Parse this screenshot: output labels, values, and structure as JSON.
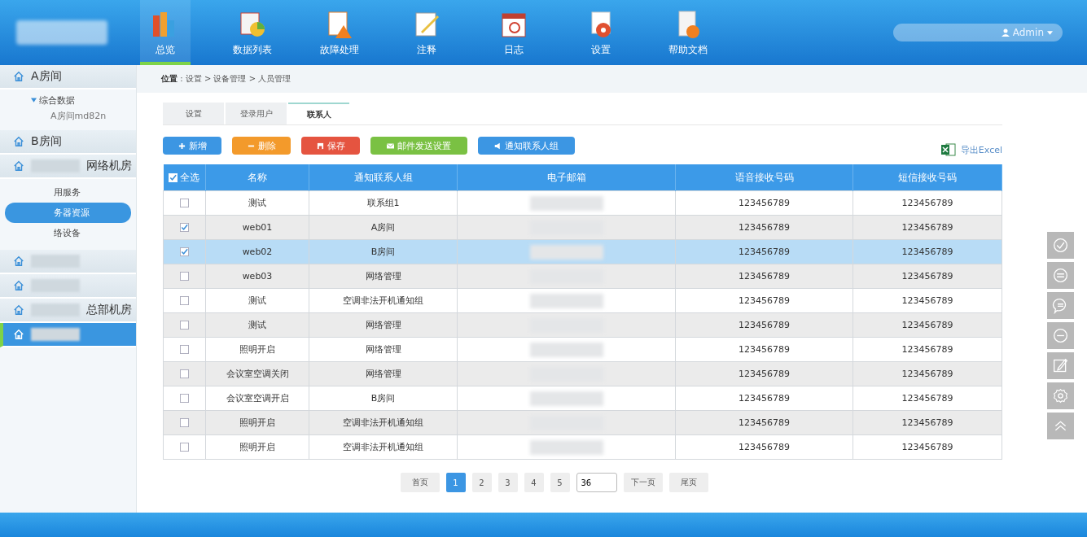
{
  "header": {
    "nav": [
      {
        "label": "总览",
        "selected": true
      },
      {
        "label": "数据列表",
        "selected": false
      },
      {
        "label": "故障处理",
        "selected": false
      },
      {
        "label": "注释",
        "selected": false
      },
      {
        "label": "日志",
        "selected": false
      },
      {
        "label": "设置",
        "selected": false
      },
      {
        "label": "帮助文档",
        "selected": false
      }
    ],
    "user": "Admin"
  },
  "sidebar": {
    "items": [
      {
        "label": "A房间",
        "selected": false,
        "children": [
          {
            "label": "综合数据",
            "kind": "folder",
            "children": [
              {
                "label": "A房间md82n",
                "kind": "leaf",
                "selected": false
              }
            ]
          }
        ]
      },
      {
        "label": "B房间",
        "selected": false
      },
      {
        "label": "网络机房",
        "selected": false,
        "children": [
          {
            "label": "用服务",
            "kind": "leaf",
            "selected": false
          },
          {
            "label": "务器资源",
            "kind": "leaf",
            "selected": true
          },
          {
            "label": "络设备",
            "kind": "leaf",
            "selected": false
          }
        ]
      },
      {
        "selected": false
      },
      {
        "selected": false
      },
      {
        "label": "总部机房",
        "selected": false
      },
      {
        "selected": true
      }
    ]
  },
  "breadcrumb": "**位置** : 设置 > 设备管理 > 人员管理",
  "tabs": [
    {
      "label": "设置",
      "selected": false
    },
    {
      "label": "登录用户",
      "selected": false
    },
    {
      "label": "联系人",
      "selected": true
    }
  ],
  "toolbar": [
    {
      "label": "新增",
      "kind": "add"
    },
    {
      "label": "删除",
      "kind": "delete"
    },
    {
      "label": "保存",
      "kind": "save"
    },
    {
      "label": "邮件发送设置",
      "kind": "mail"
    },
    {
      "label": "通知联系人组",
      "kind": "notify"
    }
  ],
  "export": "导出Excel",
  "table": {
    "select_all_checked": true,
    "columns": [
      "全选",
      "名称",
      "通知联系人组",
      "电子邮箱",
      "语音接收号码",
      "短信接收号码"
    ],
    "rows": [
      {
        "checked": false,
        "selected": false,
        "name": "测试",
        "group": "联系组1",
        "voice": "123456789",
        "sms": "123456789"
      },
      {
        "checked": true,
        "selected": false,
        "name": "web01",
        "group": "A房间",
        "voice": "123456789",
        "sms": "123456789"
      },
      {
        "checked": true,
        "selected": true,
        "name": "web02",
        "group": "B房间",
        "voice": "123456789",
        "sms": "123456789"
      },
      {
        "checked": false,
        "selected": false,
        "name": "web03",
        "group": "网络管理",
        "voice": "123456789",
        "sms": "123456789"
      },
      {
        "checked": false,
        "selected": false,
        "name": "测试",
        "group": "空调非法开机通知组",
        "voice": "123456789",
        "sms": "123456789"
      },
      {
        "checked": false,
        "selected": false,
        "name": "测试",
        "group": "网络管理",
        "voice": "123456789",
        "sms": "123456789"
      },
      {
        "checked": false,
        "selected": false,
        "name": "照明开启",
        "group": "网络管理",
        "voice": "123456789",
        "sms": "123456789"
      },
      {
        "checked": false,
        "selected": false,
        "name": "会议室空调关闭",
        "group": "网络管理",
        "voice": "123456789",
        "sms": "123456789"
      },
      {
        "checked": false,
        "selected": false,
        "name": "会议室空调开启",
        "group": "B房间",
        "voice": "123456789",
        "sms": "123456789"
      },
      {
        "checked": false,
        "selected": false,
        "name": "照明开启",
        "group": "空调非法开机通知组",
        "voice": "123456789",
        "sms": "123456789"
      },
      {
        "checked": false,
        "selected": false,
        "name": "照明开启",
        "group": "空调非法开机通知组",
        "voice": "123456789",
        "sms": "123456789"
      }
    ]
  },
  "pagination": {
    "first": "首页",
    "pages": [
      {
        "label": "1",
        "selected": true
      },
      {
        "label": "2",
        "selected": false
      },
      {
        "label": "3",
        "selected": false
      },
      {
        "label": "4",
        "selected": false
      },
      {
        "label": "5",
        "selected": false
      }
    ],
    "jump": "36",
    "next": "下一页",
    "last": "尾页"
  }
}
